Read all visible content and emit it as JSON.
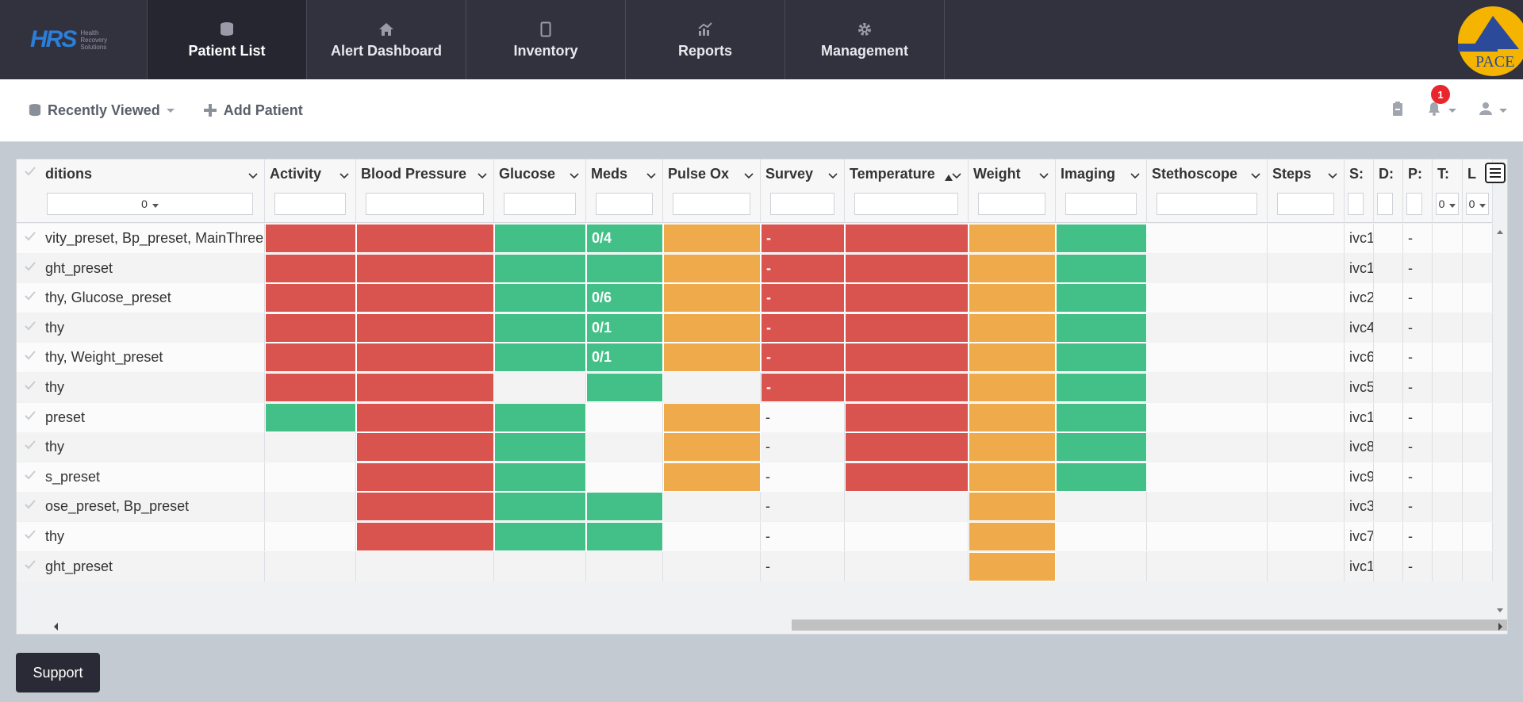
{
  "logo": {
    "text": "HRS",
    "sub": [
      "Health",
      "Recovery",
      "Solutions"
    ]
  },
  "nav": [
    {
      "label": "Patient List",
      "icon": "database-icon",
      "active": true
    },
    {
      "label": "Alert Dashboard",
      "icon": "home-icon",
      "active": false
    },
    {
      "label": "Inventory",
      "icon": "tablet-icon",
      "active": false
    },
    {
      "label": "Reports",
      "icon": "chart-icon",
      "active": false
    },
    {
      "label": "Management",
      "icon": "gear-icon",
      "active": false
    }
  ],
  "brand_right": {
    "text": "PACE"
  },
  "subheader": {
    "recently_viewed": "Recently Viewed",
    "add_patient": "Add Patient",
    "notification_count": "1"
  },
  "grid": {
    "columns": [
      {
        "title": "ditions",
        "filter": "0"
      },
      {
        "title": "Activity"
      },
      {
        "title": "Blood Pressure"
      },
      {
        "title": "Glucose"
      },
      {
        "title": "Meds"
      },
      {
        "title": "Pulse Ox"
      },
      {
        "title": "Survey"
      },
      {
        "title": "Temperature"
      },
      {
        "title": "Weight"
      },
      {
        "title": "Imaging"
      },
      {
        "title": "Stethoscope"
      },
      {
        "title": "Steps"
      },
      {
        "title": "S:"
      },
      {
        "title": "D:"
      },
      {
        "title": "P:"
      },
      {
        "title": "T:",
        "filter": "0"
      },
      {
        "title": "L",
        "filter": "0"
      }
    ],
    "rows": [
      {
        "conditions": "vity_preset, Bp_preset, MainThree,",
        "meds": "0/4",
        "survey": "-",
        "s": "ivc1",
        "p": "-",
        "status": [
          "red",
          "red",
          "green",
          "green",
          "orange",
          "red",
          "red",
          "orange",
          "green"
        ]
      },
      {
        "conditions": "ght_preset",
        "meds": "",
        "survey": "-",
        "s": "ivc1",
        "p": "-",
        "status": [
          "red",
          "red",
          "green",
          "green",
          "orange",
          "red",
          "red",
          "orange",
          "green"
        ]
      },
      {
        "conditions": "thy, Glucose_preset",
        "meds": "0/6",
        "survey": "-",
        "s": "ivc2",
        "p": "-",
        "status": [
          "red",
          "red",
          "green",
          "green",
          "orange",
          "red",
          "red",
          "orange",
          "green"
        ]
      },
      {
        "conditions": "thy",
        "meds": "0/1",
        "survey": "-",
        "s": "ivc4",
        "p": "-",
        "status": [
          "red",
          "red",
          "green",
          "green",
          "orange",
          "red",
          "red",
          "orange",
          "green"
        ]
      },
      {
        "conditions": "thy, Weight_preset",
        "meds": "0/1",
        "survey": "-",
        "s": "ivc6",
        "p": "-",
        "status": [
          "red",
          "red",
          "green",
          "green",
          "orange",
          "red",
          "red",
          "orange",
          "green"
        ]
      },
      {
        "conditions": "thy",
        "meds": "",
        "survey": "-",
        "s": "ivc5",
        "p": "-",
        "status": [
          "red",
          "red",
          "",
          "green",
          "",
          "red",
          "red",
          "orange",
          "green"
        ]
      },
      {
        "conditions": "preset",
        "meds": "",
        "survey": "-",
        "s": "ivc1",
        "p": "-",
        "status": [
          "green",
          "red",
          "green",
          "",
          "orange",
          "",
          "red",
          "orange",
          "green"
        ]
      },
      {
        "conditions": "thy",
        "meds": "",
        "survey": "-",
        "s": "ivc8",
        "p": "-",
        "status": [
          "",
          "red",
          "green",
          "",
          "orange",
          "",
          "red",
          "orange",
          "green"
        ]
      },
      {
        "conditions": "s_preset",
        "meds": "",
        "survey": "-",
        "s": "ivc9",
        "p": "-",
        "status": [
          "",
          "red",
          "green",
          "",
          "orange",
          "",
          "red",
          "orange",
          "green"
        ]
      },
      {
        "conditions": "ose_preset, Bp_preset",
        "meds": "",
        "survey": "-",
        "s": "ivc3",
        "p": "-",
        "status": [
          "",
          "red",
          "green",
          "green",
          "",
          "",
          "",
          "orange",
          ""
        ]
      },
      {
        "conditions": "thy",
        "meds": "",
        "survey": "-",
        "s": "ivc7",
        "p": "-",
        "status": [
          "",
          "red",
          "green",
          "green",
          "",
          "",
          "",
          "orange",
          ""
        ]
      },
      {
        "conditions": "ght_preset",
        "meds": "",
        "survey": "-",
        "s": "ivc1",
        "p": "-",
        "status": [
          "",
          "",
          "",
          "",
          "",
          "",
          "",
          "orange",
          ""
        ]
      }
    ]
  },
  "support_label": "Support",
  "colors": {
    "red": "#d9534f",
    "green": "#43bf88",
    "orange": "#efab4b",
    "nav_bg": "#32323f"
  }
}
